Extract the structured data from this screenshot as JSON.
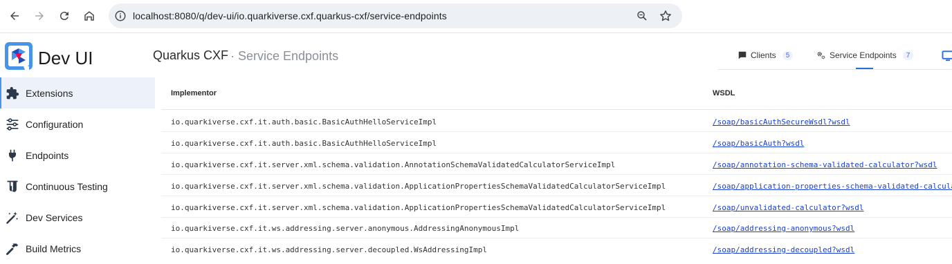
{
  "browser": {
    "url": "localhost:8080/q/dev-ui/io.quarkiverse.cxf.quarkus-cxf/service-endpoints",
    "back_icon": "arrow-left-icon",
    "forward_icon": "arrow-right-icon",
    "reload_icon": "reload-icon",
    "home_icon": "home-icon"
  },
  "app": {
    "title": "Dev UI"
  },
  "sidebar": {
    "items": [
      {
        "label": "Extensions",
        "icon": "puzzle-icon",
        "active": true
      },
      {
        "label": "Configuration",
        "icon": "sliders-icon",
        "active": false
      },
      {
        "label": "Endpoints",
        "icon": "plug-icon",
        "active": false
      },
      {
        "label": "Continuous Testing",
        "icon": "flask-icon",
        "active": false
      },
      {
        "label": "Dev Services",
        "icon": "magic-wand-icon",
        "active": false
      },
      {
        "label": "Build Metrics",
        "icon": "hammer-icon",
        "active": false
      }
    ]
  },
  "header": {
    "title": "Quarkus CXF",
    "subtitle": "· Service Endpoints"
  },
  "tabs": [
    {
      "label": "Clients",
      "badge": "5",
      "icon": "comment-icon"
    },
    {
      "label": "Service Endpoints",
      "badge": "7",
      "icon": "gears-icon",
      "active": true
    }
  ],
  "table": {
    "columns": [
      "Implementor",
      "WSDL"
    ],
    "rows": [
      {
        "implementor": "io.quarkiverse.cxf.it.auth.basic.BasicAuthHelloServiceImpl",
        "wsdl": "/soap/basicAuthSecureWsdl?wsdl"
      },
      {
        "implementor": "io.quarkiverse.cxf.it.auth.basic.BasicAuthHelloServiceImpl",
        "wsdl": "/soap/basicAuth?wsdl"
      },
      {
        "implementor": "io.quarkiverse.cxf.it.server.xml.schema.validation.AnnotationSchemaValidatedCalculatorServiceImpl",
        "wsdl": "/soap/annotation-schema-validated-calculator?wsdl"
      },
      {
        "implementor": "io.quarkiverse.cxf.it.server.xml.schema.validation.ApplicationPropertiesSchemaValidatedCalculatorServiceImpl",
        "wsdl": "/soap/application-properties-schema-validated-calculator?wsdl"
      },
      {
        "implementor": "io.quarkiverse.cxf.it.server.xml.schema.validation.ApplicationPropertiesSchemaValidatedCalculatorServiceImpl",
        "wsdl": "/soap/unvalidated-calculator?wsdl"
      },
      {
        "implementor": "io.quarkiverse.cxf.it.ws.addressing.server.anonymous.AddressingAnonymousImpl",
        "wsdl": "/soap/addressing-anonymous?wsdl"
      },
      {
        "implementor": "io.quarkiverse.cxf.it.ws.addressing.server.decoupled.WsAddressingImpl",
        "wsdl": "/soap/addressing-decoupled?wsdl"
      }
    ]
  },
  "colors": {
    "accent": "#4695eb",
    "link": "#1a3fd1",
    "active_bg": "#edf1f9",
    "omnibox_bg": "#edf0f5"
  }
}
